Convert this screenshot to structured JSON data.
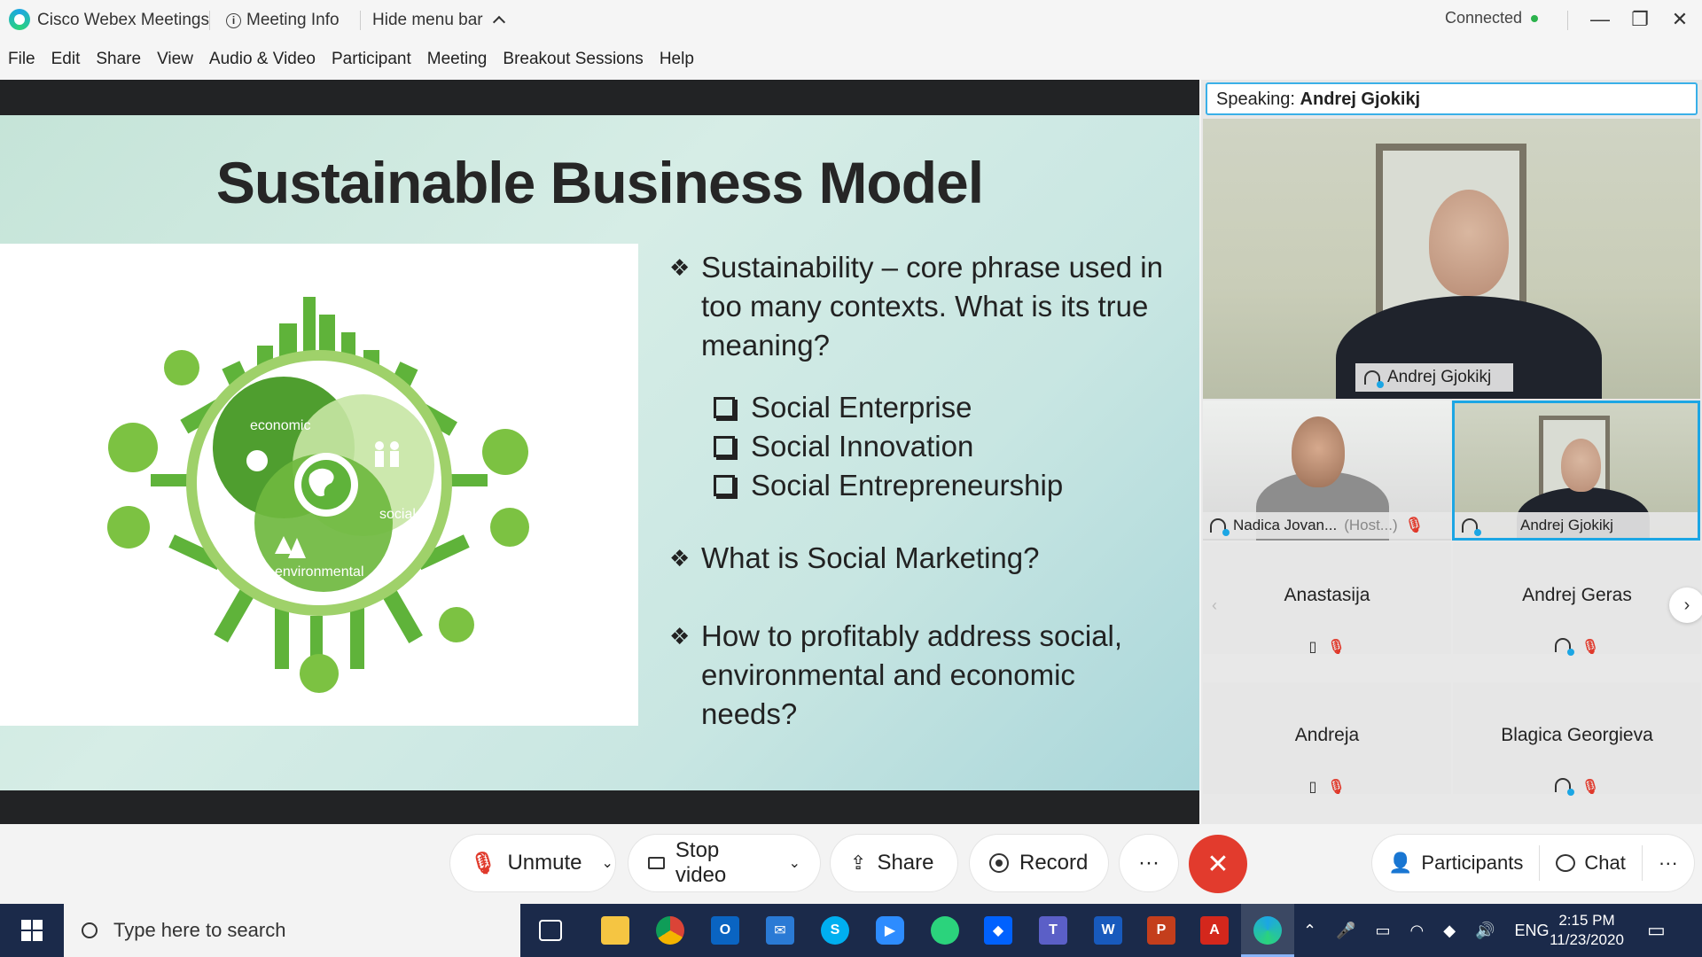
{
  "titlebar": {
    "app_name": "Cisco Webex Meetings",
    "meeting_info": "Meeting Info",
    "hide_menu": "Hide menu bar",
    "status": "Connected",
    "minimize": "—",
    "restore": "❐",
    "close": "✕"
  },
  "menu": [
    "File",
    "Edit",
    "Share",
    "View",
    "Audio & Video",
    "Participant",
    "Meeting",
    "Breakout Sessions",
    "Help"
  ],
  "slide": {
    "title": "Sustainable Business Model",
    "diagram": {
      "economic": "economic",
      "social": "social",
      "environmental": "environmental"
    },
    "bullet1": "Sustainability – core phrase used in too many contexts. What is its true meaning?",
    "sub_items": [
      "Social Enterprise",
      "Social Innovation",
      "Social Entrepreneurship"
    ],
    "bullet2": "What is Social Marketing?",
    "bullet3": "How to profitably address social, environmental and economic needs?"
  },
  "panel": {
    "speaking_label": "Speaking:",
    "speaking_name": "Andrej Gjokikj",
    "main_name": "Andrej Gjokikj",
    "thumb1_name": "Nadica Jovan...",
    "thumb1_role": "(Host...)",
    "thumb2_name": "Andrej Gjokikj",
    "tiles": [
      {
        "name": "Anastasija"
      },
      {
        "name": "Andrej Geras"
      },
      {
        "name": "Andreja"
      },
      {
        "name": "Blagica Georgieva"
      }
    ]
  },
  "controls": {
    "unmute": "Unmute",
    "stop_video": "Stop video",
    "share": "Share",
    "record": "Record",
    "more": "···",
    "end": "✕",
    "participants": "Participants",
    "chat": "Chat",
    "more_right": "···"
  },
  "taskbar": {
    "search_placeholder": "Type here to search",
    "lang": "ENG",
    "time": "2:15 PM",
    "date": "11/23/2020"
  },
  "colors": {
    "accent": "#1ca6e4",
    "end_call": "#e23b2d",
    "connected": "#2bb24c",
    "slide_green": "#5fb33a"
  }
}
